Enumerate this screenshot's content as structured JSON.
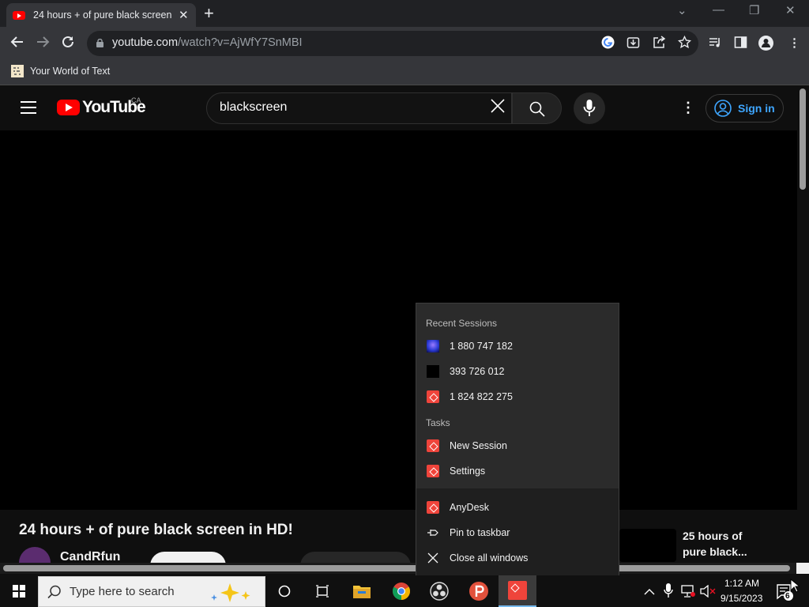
{
  "browser": {
    "tab_title": "24 hours + of pure black screen in HD!",
    "tab_close": "✕",
    "new_tab": "+",
    "window_controls": [
      "⌄",
      "—",
      "❐",
      "✕"
    ],
    "url_host": "youtube.com",
    "url_path": "/watch?v=AjWfY7SnMBI",
    "bookmark": "Your World of Text"
  },
  "youtube": {
    "logo_text": "YouTube",
    "region": "CA",
    "search_value": "blackscreen",
    "sign_in": "Sign in",
    "video_title": "24 hours + of pure black screen in HD!",
    "channel": "CandRfun",
    "suggested_title": "25 hours of pure black..."
  },
  "jumplist": {
    "recent_header": "Recent Sessions",
    "recent": [
      "1 880 747 182",
      "393 726 012",
      "1 824 822 275"
    ],
    "tasks_header": "Tasks",
    "tasks": [
      "New Session",
      "Settings"
    ],
    "app": "AnyDesk",
    "pin": "Pin to taskbar",
    "close_all": "Close all windows"
  },
  "taskbar": {
    "search_placeholder": "Type here to search",
    "time": "1:12 AM",
    "date": "9/15/2023",
    "notification_count": "6"
  },
  "colors": {
    "youtube_red": "#ff0000",
    "anydesk_red": "#ef443b",
    "link_blue": "#3ea6ff"
  }
}
